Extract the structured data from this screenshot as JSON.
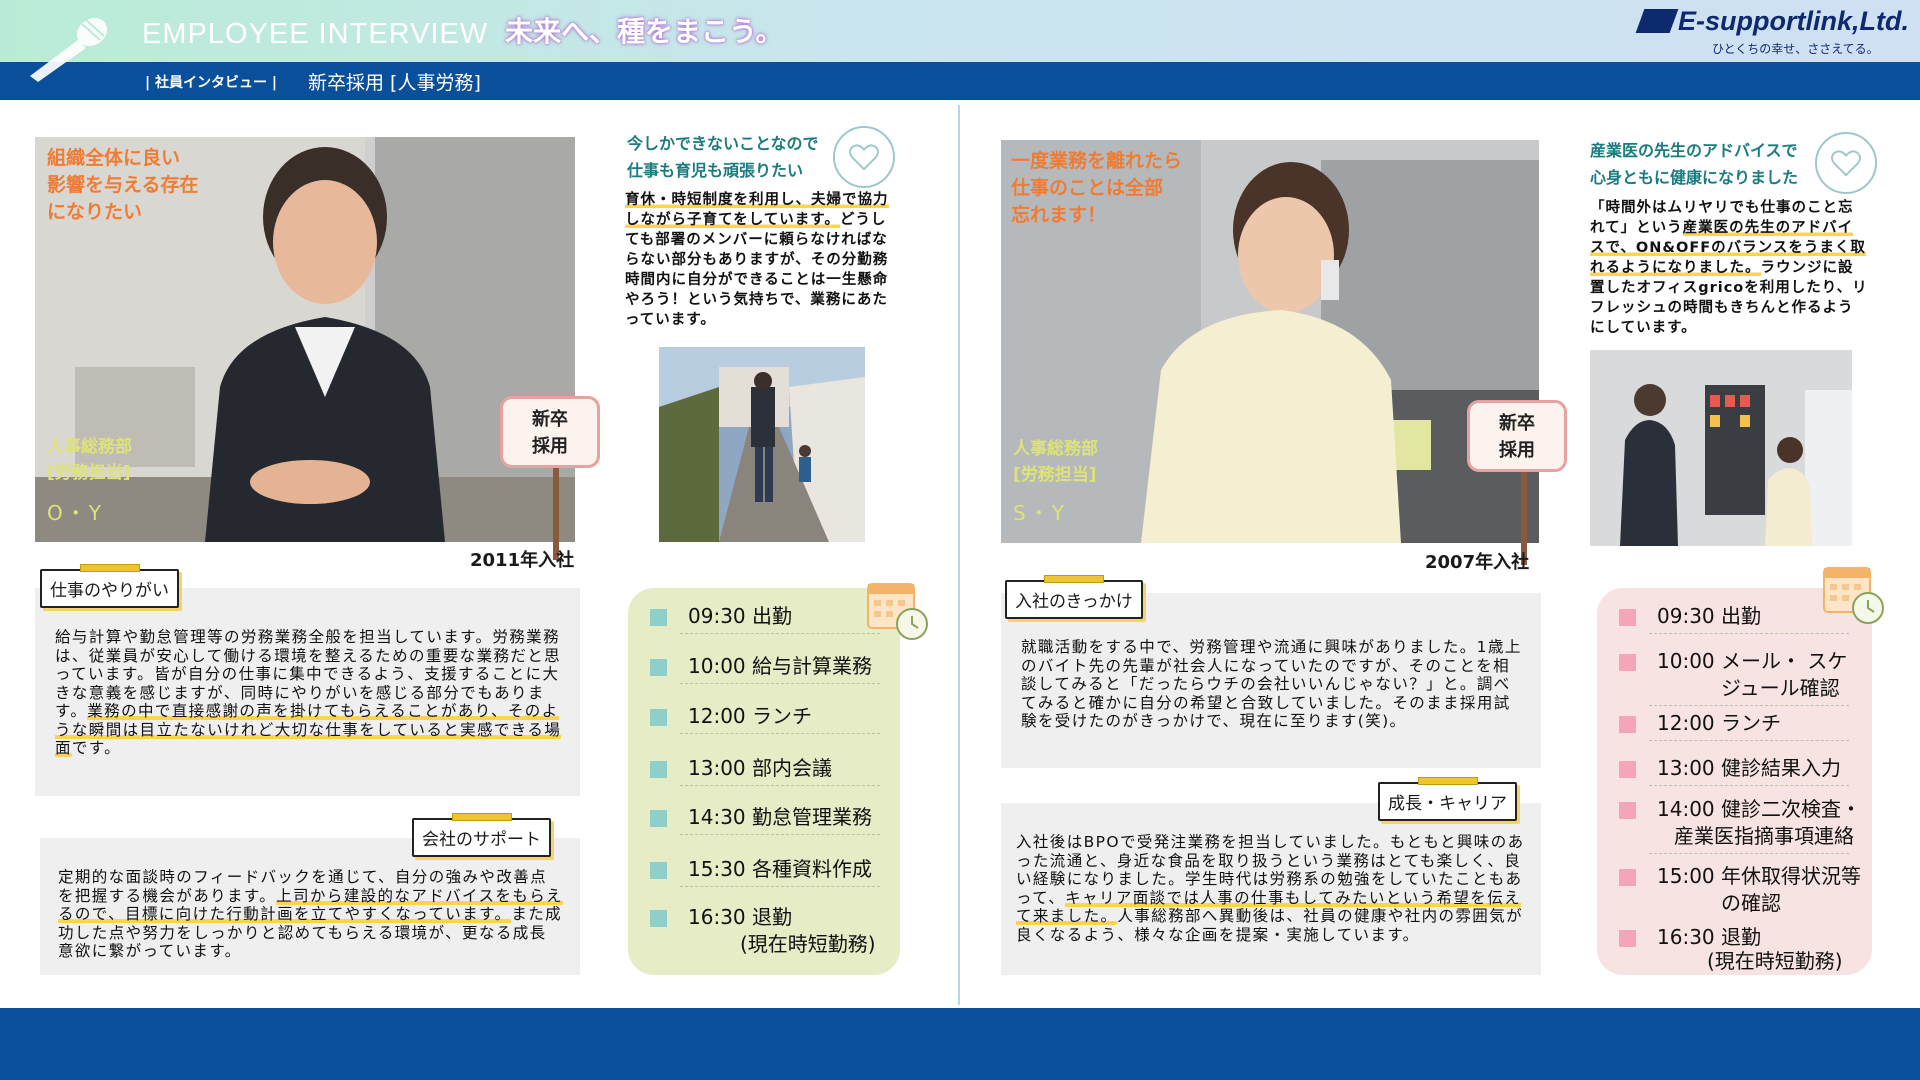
{
  "header": {
    "title": "EMPLOYEE INTERVIEW",
    "slogan": "未来へ、種をまこう。",
    "logo": "E-supportlink,Ltd.",
    "logo_sub": "ひとくちの幸せ、ささえてる。",
    "band_sub1": "| 社員インタビュー |",
    "band_sub2": "新卒採用 [人事労務]"
  },
  "left": {
    "photo_tagline": [
      "組織全体に良い",
      "影響を与える存在",
      "になりたい"
    ],
    "dept": [
      "人事総務部",
      "[労務担当]"
    ],
    "initials": "O・Y",
    "badge": [
      "新卒",
      "採用"
    ],
    "year": "2011年入社",
    "comment_title": [
      "今しかできないことなので",
      "仕事も育児も頑張りたい"
    ],
    "comment_body_hl": "育休・時短制度を利用し、夫婦で協力しながら子育てをしています。",
    "comment_body": "どうしても部署のメンバーに頼らなければならない部分もありますが、その分勤務時間内に自分ができることは一生懸命やろう！という気持ちで、業務にあたっています。",
    "label1": "仕事のやりがい",
    "text1": "給与計算や勤怠管理等の労務業務全般を担当しています。労務業務は、従業員が安心して働ける環境を整えるための重要な業務だと思っています。皆が自分の仕事に集中できるよう、支援することに大きな意義を感じますが、同時にやりがいを感じる部分でもあります。",
    "text1_hl": "業務の中で直接感謝の声を掛けてもらえることがあり、そのような瞬間は目立たないけれど大切な仕事をしていると実感できる場面",
    "text1_tail": "です。",
    "label2": "会社のサポート",
    "text2": "定期的な面談時のフィードバックを通じて、自分の強みや改善点を把握する機会があります。",
    "text2_hl": "上司から建設的なアドバイスをもらえるので、目標に向けた行動計画を立てやすくなっています。",
    "text2_tail": "また成功した点や努力をしっかりと認めてもらえる環境が、更なる成長意欲に繋がっています。",
    "schedule_color": "#e6ecc6",
    "schedule_square": "#8ecfc9",
    "schedule": [
      "09:30 出勤",
      "10:00 給与計算業務",
      "12:00 ランチ",
      "13:00 部内会議",
      "14:30 勤怠管理業務",
      "15:30 各種資料作成",
      "16:30 退勤"
    ],
    "schedule_note": "(現在時短勤務)"
  },
  "right": {
    "photo_tagline": [
      "一度業務を離れたら",
      "仕事のことは全部",
      "忘れます！"
    ],
    "dept": [
      "人事総務部",
      "[労務担当]"
    ],
    "initials": "S・Y",
    "badge": [
      "新卒",
      "採用"
    ],
    "year": "2007年入社",
    "comment_title": [
      "産業医の先生のアドバイスで",
      "心身ともに健康になりました"
    ],
    "comment_body_a": "「時間外はムリヤリでも仕事のこと忘れて」という",
    "comment_body_hl": "産業医の先生のアドバイスで、ON&OFFのバランスをうまく取れるようになりました。",
    "comment_body_b": "ラウンジに設置したオフィスgricoを利用したり、リフレッシュの時間もきちんと作るようにしています。",
    "label1": "入社のきっかけ",
    "text1": "就職活動をする中で、労務管理や流通に興味がありました。1歳上のバイト先の先輩が社会人になっていたのですが、そのことを相談してみると「だったらウチの会社いいんじゃない？」と。調べてみると確かに自分の希望と合致していました。そのまま採用試験を受けたのがきっかけで、現在に至ります(笑)。",
    "label2": "成長・キャリア",
    "text2": "入社後はBPOで受発注業務を担当していました。もともと興味のあった流通と、身近な食品を取り扱うという業務はとても楽しく、良い経験になりました。学生時代は労務系の勉強をしていたこともあって、",
    "text2_hl": "キャリア面談では人事の仕事もしてみたいという希望を伝えて来ました。",
    "text2_tail": "人事総務部へ異動後は、社員の健康や社内の雰囲気が良くなるよう、様々な企画を提案・実施しています。",
    "schedule_color": "#f7e3e2",
    "schedule_square": "#f4a5b8",
    "schedule": [
      "09:30 出勤",
      "10:00 メール・ スケ",
      "ジュール確認",
      "12:00 ランチ",
      "13:00 健診結果入力",
      "14:00 健診二次検査・",
      "産業医指摘事項連絡",
      "15:00 年休取得状況等",
      "の確認",
      "16:30 退勤"
    ],
    "schedule_note": "(現在時短勤務)"
  }
}
